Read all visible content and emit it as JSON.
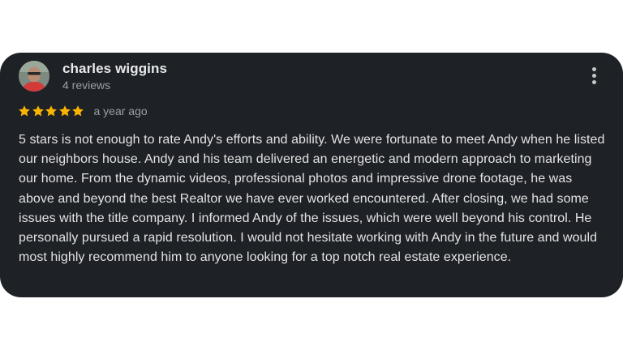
{
  "reviewer": {
    "name": "charles wiggins",
    "review_count": "4 reviews",
    "avatar": "user-photo"
  },
  "rating": {
    "stars": 5,
    "max_stars": 5,
    "star_color": "#f9b401",
    "time_ago": "a year ago"
  },
  "review": {
    "text": "5 stars is not enough to rate Andy's efforts and ability. We were fortunate to meet Andy when he listed our neighbors house. Andy and his team delivered an energetic and modern approach to marketing our home. From the dynamic videos, professional photos and impressive drone footage, he was above and beyond the best Realtor we have ever worked encountered. After closing, we had some issues with the title company. I informed Andy of the issues, which were well beyond his control. He personally pursued a rapid resolution. I would not hesitate working with Andy in the future and would most highly recommend him to anyone looking for a top notch real estate experience."
  },
  "menu": {
    "icon": "more-vertical-icon"
  },
  "colors": {
    "card_background": "#1e2126",
    "page_background": "#ffffff",
    "name_text": "#e8eaed",
    "secondary_text": "#9aa0a6",
    "body_text": "#e3e3e3"
  }
}
